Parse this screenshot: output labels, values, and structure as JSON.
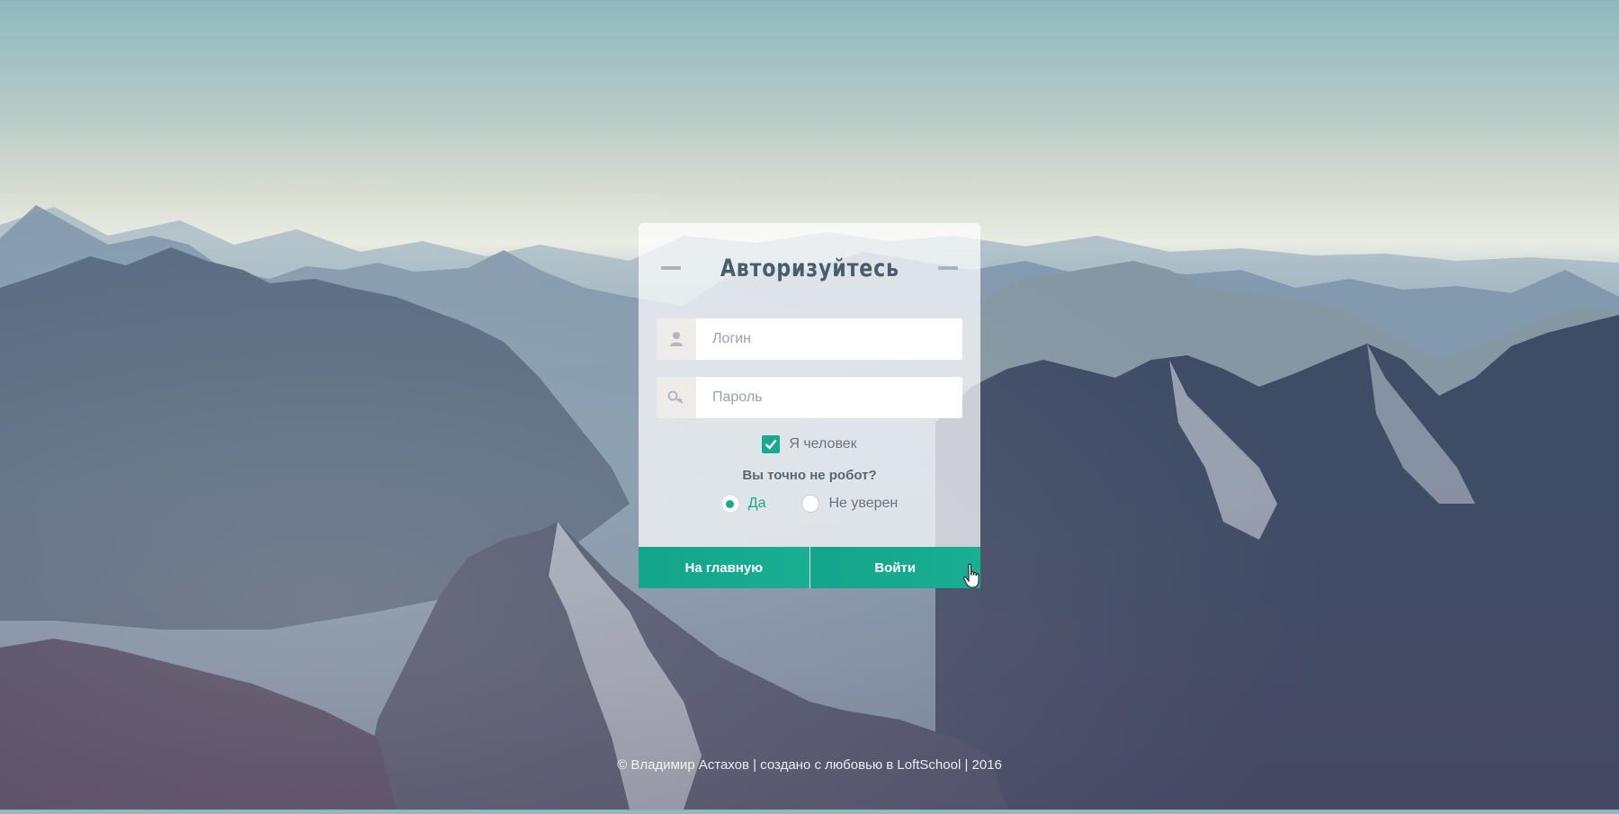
{
  "page": {
    "colors": {
      "accent": "#19a98f",
      "title": "#495d6b"
    }
  },
  "login_card": {
    "title": "Авторизуйтесь",
    "login_field": {
      "placeholder": "Логин",
      "icon": "user-icon"
    },
    "password_field": {
      "placeholder": "Пароль",
      "icon": "key-icon"
    },
    "human_checkbox": {
      "label": "Я человек",
      "checked": true
    },
    "robot_question": {
      "label": "Вы точно не робот?",
      "options": [
        {
          "label": "Да",
          "selected": true
        },
        {
          "label": "Не уверен",
          "selected": false
        }
      ]
    },
    "buttons": {
      "home": "На главную",
      "login": "Войти"
    }
  },
  "footer": {
    "text": "© Владимир Астахов | создано с любовью в LoftSchool | 2016"
  }
}
